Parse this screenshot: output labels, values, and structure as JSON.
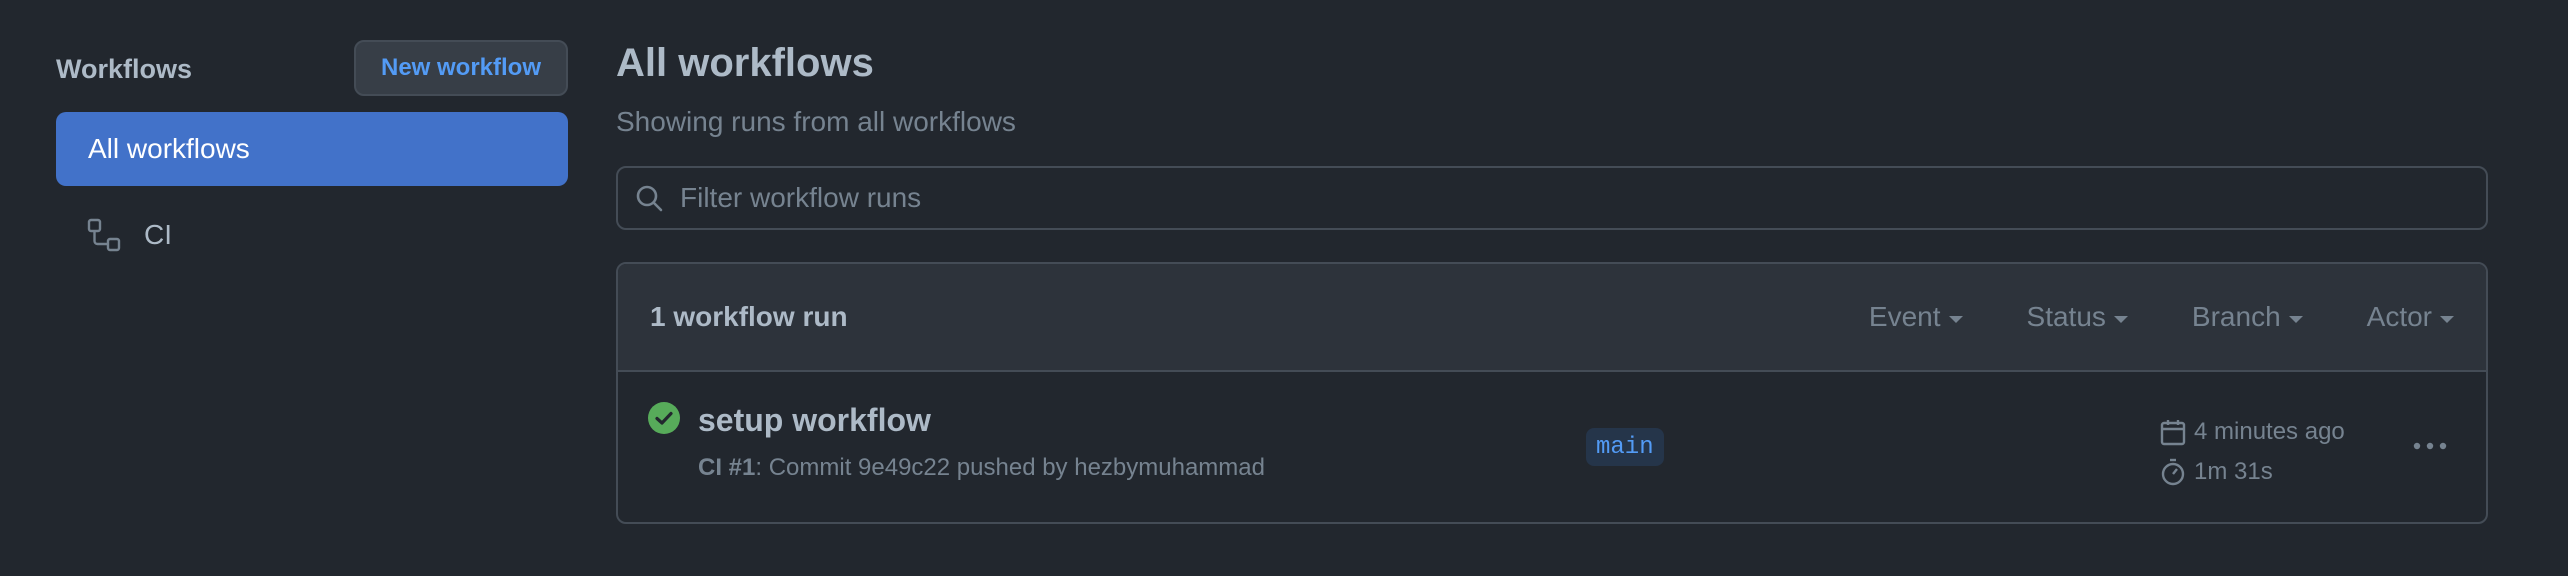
{
  "sidebar": {
    "title": "Workflows",
    "new_workflow_label": "New workflow",
    "items": [
      {
        "label": "All workflows",
        "active": true
      },
      {
        "label": "CI",
        "icon": "workflow-icon"
      }
    ]
  },
  "main": {
    "title": "All workflows",
    "subtitle": "Showing runs from all workflows",
    "filter": {
      "placeholder": "Filter workflow runs",
      "value": ""
    },
    "runs": {
      "count_label": "1 workflow run",
      "filters": [
        "Event",
        "Status",
        "Branch",
        "Actor"
      ],
      "items": [
        {
          "status": "success",
          "title": "setup workflow",
          "workflow_name": "CI #1",
          "meta_rest": ": Commit 9e49c22 pushed by hezbymuhammad",
          "branch": "main",
          "time_ago": "4 minutes ago",
          "duration": "1m 31s"
        }
      ]
    }
  },
  "colors": {
    "background": "#22272e",
    "accent": "#539bf5",
    "active_nav": "#4272c9",
    "success": "#57ab5a"
  }
}
